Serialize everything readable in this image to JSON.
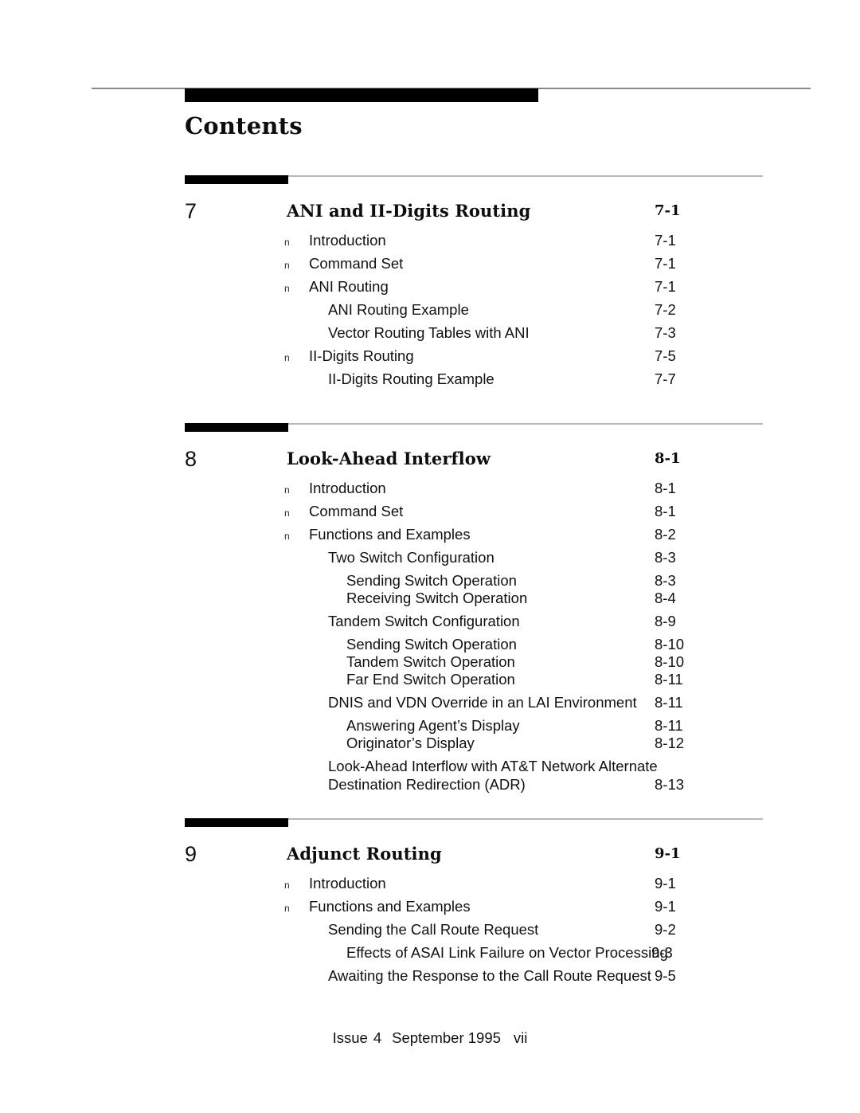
{
  "page": {
    "title": "Contents",
    "bullet_glyph": "n"
  },
  "footer": {
    "issue_label": "Issue",
    "issue_number": "4",
    "date": "September 1995",
    "folio": "vii"
  },
  "colors": {
    "rule_gray": "#8a8a8a",
    "section_rule_gray": "#b8b8b8",
    "bar_black": "#000000",
    "text": "#111111"
  },
  "chapters": [
    {
      "number": "7",
      "title": "ANI and II-Digits Routing",
      "page": "7-1",
      "entries": [
        {
          "level": 2,
          "bullet": true,
          "label": "Introduction",
          "page": "7-1"
        },
        {
          "level": 2,
          "bullet": true,
          "label": "Command Set",
          "page": "7-1"
        },
        {
          "level": 2,
          "bullet": true,
          "label": "ANI Routing",
          "page": "7-1"
        },
        {
          "level": 3,
          "bullet": false,
          "label": "ANI Routing Example",
          "page": "7-2"
        },
        {
          "level": 3,
          "bullet": false,
          "label": "Vector Routing Tables with ANI",
          "page": "7-3"
        },
        {
          "level": 2,
          "bullet": true,
          "label": "II-Digits Routing",
          "page": "7-5"
        },
        {
          "level": 3,
          "bullet": false,
          "label": "II-Digits Routing Example",
          "page": "7-7"
        }
      ]
    },
    {
      "number": "8",
      "title": "Look-Ahead Interflow",
      "page": "8-1",
      "entries": [
        {
          "level": 2,
          "bullet": true,
          "label": "Introduction",
          "page": "8-1"
        },
        {
          "level": 2,
          "bullet": true,
          "label": "Command Set",
          "page": "8-1"
        },
        {
          "level": 2,
          "bullet": true,
          "label": "Functions and Examples",
          "page": "8-2"
        },
        {
          "level": 3,
          "bullet": false,
          "label": "Two Switch Configuration",
          "page": "8-3"
        },
        {
          "level": 4,
          "bullet": false,
          "label": "Sending Switch Operation",
          "page": "8-3"
        },
        {
          "level": 4,
          "bullet": false,
          "label": "Receiving Switch Operation",
          "page": "8-4"
        },
        {
          "level": 3,
          "bullet": false,
          "label": "Tandem Switch Configuration",
          "page": "8-9"
        },
        {
          "level": 4,
          "bullet": false,
          "label": "Sending Switch Operation",
          "page": "8-10"
        },
        {
          "level": 4,
          "bullet": false,
          "label": "Tandem Switch Operation",
          "page": "8-10"
        },
        {
          "level": 4,
          "bullet": false,
          "label": "Far End Switch Operation",
          "page": "8-11"
        },
        {
          "level": 3,
          "bullet": false,
          "label": "DNIS and VDN Override in an LAI Environment",
          "page": "8-11"
        },
        {
          "level": 4,
          "bullet": false,
          "label": "Answering Agent’s Display",
          "page": "8-11"
        },
        {
          "level": 4,
          "bullet": false,
          "label": "Originator’s Display",
          "page": "8-12"
        },
        {
          "level": 3,
          "bullet": false,
          "wrapped": true,
          "label": "Look-Ahead Interflow with AT&T Network Alternate Destination Redirection (ADR)",
          "page": "8-13"
        }
      ]
    },
    {
      "number": "9",
      "title": "Adjunct Routing",
      "page": "9-1",
      "entries": [
        {
          "level": 2,
          "bullet": true,
          "label": "Introduction",
          "page": "9-1"
        },
        {
          "level": 2,
          "bullet": true,
          "label": "Functions and Examples",
          "page": "9-1"
        },
        {
          "level": 3,
          "bullet": false,
          "label": "Sending the Call Route Request",
          "page": "9-2"
        },
        {
          "level": 4,
          "bullet": false,
          "tight": true,
          "label": "Effects of ASAI Link Failure on Vector Processing",
          "page": "9-3"
        },
        {
          "level": 3,
          "bullet": false,
          "label": "Awaiting the Response to the Call Route Request",
          "page": "9-5"
        }
      ]
    }
  ]
}
